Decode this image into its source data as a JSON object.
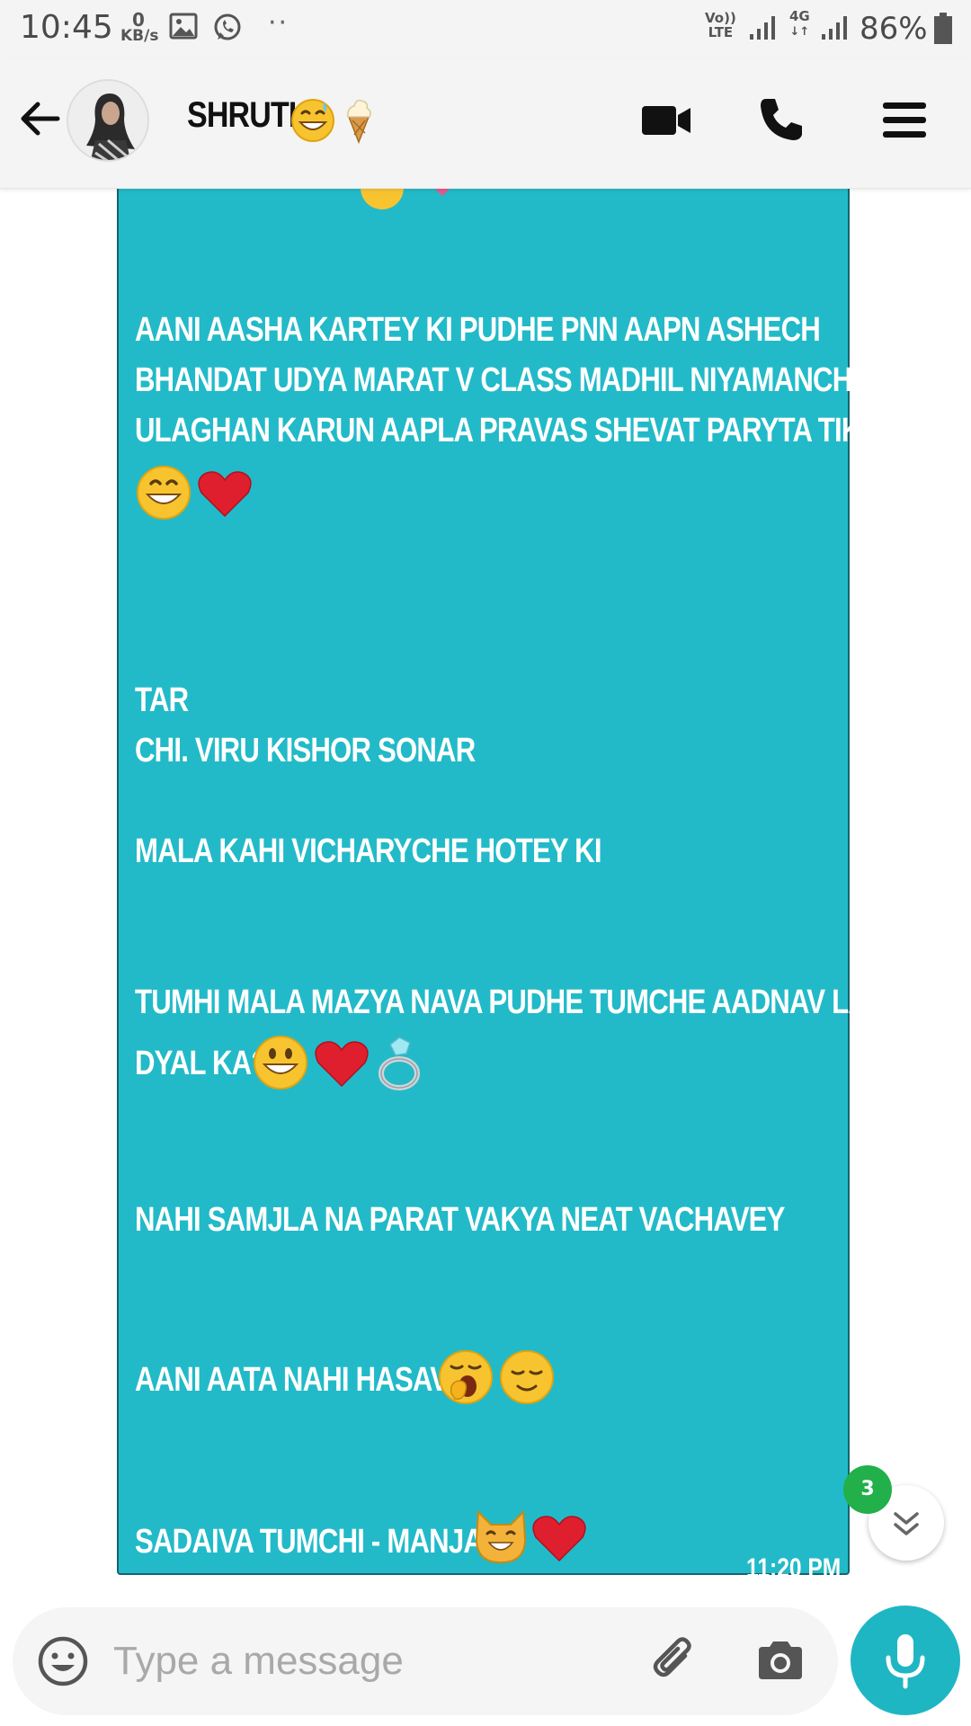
{
  "status_bar": {
    "time": "10:45",
    "net_speed_value": "0",
    "net_speed_unit": "KB/s",
    "volte_line1": "Vo))",
    "volte_line2": "LTE",
    "network_type": "4G",
    "battery": "86%"
  },
  "header": {
    "contact_name": "SHRUTI",
    "emojis": [
      "grinning-sweat",
      "soft-ice-cream"
    ]
  },
  "message": {
    "lines": [
      "AANI AASHA KARTEY KI PUDHE PNN AAPN ASHECH",
      "BHANDAT UDYA MARAT V CLASS MADHIL NIYAMANCHE",
      "ULAGHAN KARUN AAPLA PRAVAS SHEVAT PARYTA TIKAVA",
      "TAR",
      "CHI. VIRU KISHOR SONAR",
      "MALA KAHI VICHARYCHE HOTEY KI",
      "TUMHI MALA MAZYA NAVA PUDHE TUMCHE AADNAV LAU",
      "DYAL KA?",
      "NAHI SAMJLA NA PARAT VAKYA NEAT VACHAVEY",
      "AANI AATA NAHI HASAVE",
      "SADAIVA TUMCHI - MANJAR"
    ],
    "time": "11:20 PM"
  },
  "unread_count": "3",
  "input": {
    "placeholder": "Type a message"
  },
  "colors": {
    "bubble": "#22bac8",
    "bubble_border": "#17636e",
    "badge": "#21b04a",
    "mic_button": "#1fb6c4"
  }
}
